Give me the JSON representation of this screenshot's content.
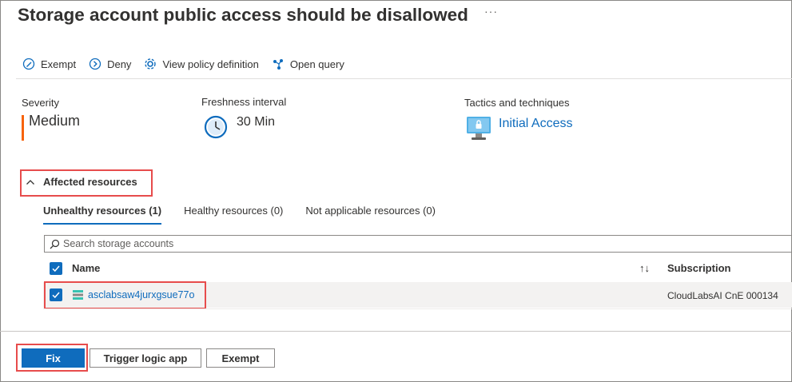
{
  "header": {
    "title": "Storage account public access should be disallowed",
    "more_label": "···"
  },
  "toolbar": {
    "items": [
      {
        "label": "Exempt",
        "icon": "exempt-icon"
      },
      {
        "label": "Deny",
        "icon": "deny-icon"
      },
      {
        "label": "View policy definition",
        "icon": "policy-icon"
      },
      {
        "label": "Open query",
        "icon": "query-icon"
      }
    ]
  },
  "essentials": {
    "severity_label": "Severity",
    "severity_value": "Medium",
    "freshness_label": "Freshness interval",
    "freshness_value": "30 Min",
    "tactics_label": "Tactics and techniques",
    "tactics_value": "Initial Access"
  },
  "affected": {
    "heading": "Affected resources",
    "tabs": [
      {
        "label": "Unhealthy resources (1)",
        "active": true
      },
      {
        "label": "Healthy resources (0)",
        "active": false
      },
      {
        "label": "Not applicable resources (0)",
        "active": false
      }
    ],
    "search_placeholder": "Search storage accounts",
    "columns": {
      "name": "Name",
      "sort": "↑↓",
      "subscription": "Subscription"
    },
    "rows": [
      {
        "name": "asclabsaw4jurxgsue77o",
        "subscription": "CloudLabsAI CnE 000134",
        "checked": true
      }
    ]
  },
  "footer": {
    "fix_label": "Fix",
    "trigger_label": "Trigger logic app",
    "exempt_label": "Exempt"
  },
  "colors": {
    "accent": "#0f6cbd",
    "severity_medium": "#f7630c",
    "highlight_box": "#e74c4c"
  }
}
